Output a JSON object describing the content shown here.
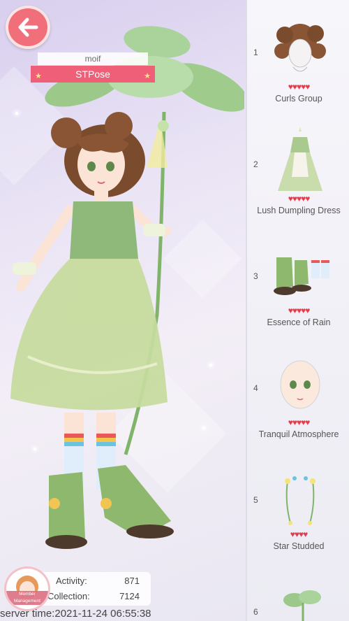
{
  "header": {
    "author_name": "moif",
    "outfit_title": "STPose"
  },
  "items": [
    {
      "index": "1",
      "name": "Curls Group",
      "hearts": 5
    },
    {
      "index": "2",
      "name": "Lush Dumpling Dress",
      "hearts": 5
    },
    {
      "index": "3",
      "name": "Essence of Rain",
      "hearts": 5
    },
    {
      "index": "4",
      "name": "Tranquil Atmosphere",
      "hearts": 5
    },
    {
      "index": "5",
      "name": "Star Studded",
      "hearts": 4
    },
    {
      "index": "6",
      "name": "",
      "hearts": 0
    }
  ],
  "stats": {
    "activity_label": "Activity:",
    "activity_value": "871",
    "collection_label": "Collection:",
    "collection_value": "7124"
  },
  "member_button_label": "Member Management",
  "server_time": "server time:2021-11-24 06:55:38",
  "colors": {
    "accent": "#ef5f78",
    "back_button": "#f06f7a",
    "heart": "#e0404e",
    "dress_green": "#a8c98a"
  },
  "icons": {
    "back": "arrow-left-icon",
    "heart": "heart-icon"
  }
}
